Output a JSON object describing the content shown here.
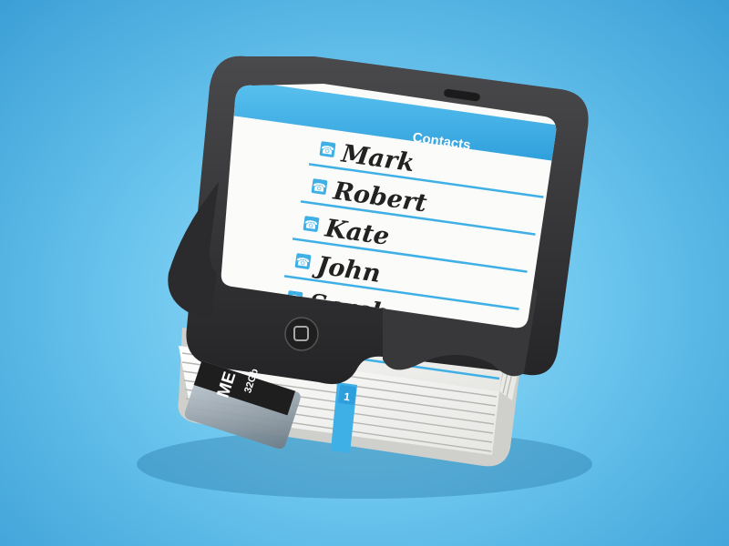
{
  "header": {
    "title": "Contacts"
  },
  "contacts": [
    {
      "name": "Mark"
    },
    {
      "name": "Robert"
    },
    {
      "name": "Kate"
    },
    {
      "name": "John"
    },
    {
      "name": "Sarah"
    }
  ],
  "page_tab": {
    "number": "1"
  },
  "memory_card": {
    "brand": "ME",
    "capacity": "32Gb"
  },
  "colors": {
    "accent": "#3fb0e6",
    "background": "#6cc6ee",
    "case": "#2f2f31",
    "paper": "#f7f7f5"
  },
  "icons": [
    "phone-icon",
    "home-button-icon"
  ]
}
